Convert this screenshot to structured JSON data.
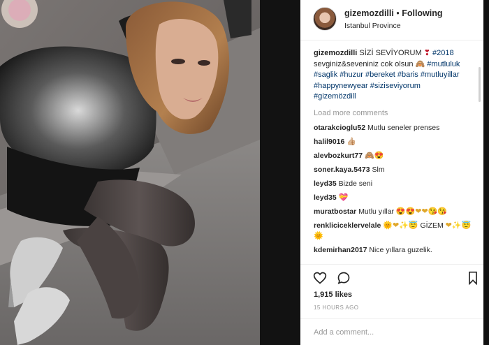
{
  "post": {
    "author": "gizemozdilli",
    "separator": "•",
    "follow_status": "Following",
    "location": "Istanbul Province"
  },
  "caption": {
    "username": "gizemozdilli",
    "text": "SİZİ SEVİYORUM",
    "heart_emoji": "❣",
    "hashtags_line1": "#2018",
    "text2": "sevginiz&seveniniz cok olsun",
    "hashtag_mutluluk": "#mutluluk",
    "hashtags_line3": "#saglik #huzur #bereket #baris #mutluyillar",
    "hashtags_line4": "#happynewyear #siziseviyorum",
    "hashtags_line5": "#gizemözdill"
  },
  "load_more": "Load more comments",
  "comments": [
    {
      "user": "otarakcioglu52",
      "text": "Mutlu seneler prenses"
    },
    {
      "user": "halil9016",
      "text": "👍🏼"
    },
    {
      "user": "alevbozkurt77",
      "text": "🙈😍"
    },
    {
      "user": "soner.kaya.5473",
      "text": "Slm"
    },
    {
      "user": "leyd35",
      "text": "Bizde seni"
    },
    {
      "user": "leyd35",
      "text": "💝"
    },
    {
      "user": "muratbostar",
      "text": "Mutlu yıllar",
      "emoji": "😍😍❤❤😘😘"
    },
    {
      "user": "renklicicekler​velale",
      "text": "🌞❤✨😇",
      "text2": "GİZEM",
      "emoji": "❤✨😇🌞"
    },
    {
      "user": "kdemirhan2017",
      "text": "Nice yıllara guzelik."
    }
  ],
  "stats": {
    "likes": "1,915 likes",
    "time": "15 HOURS AGO"
  },
  "add_comment": {
    "placeholder": "Add a comment..."
  },
  "icons": {
    "like": "heart-outline-icon",
    "comment": "speech-bubble-icon",
    "save": "bookmark-icon"
  },
  "colors": {
    "hashtag": "#003569",
    "secondary_text": "#999999"
  }
}
